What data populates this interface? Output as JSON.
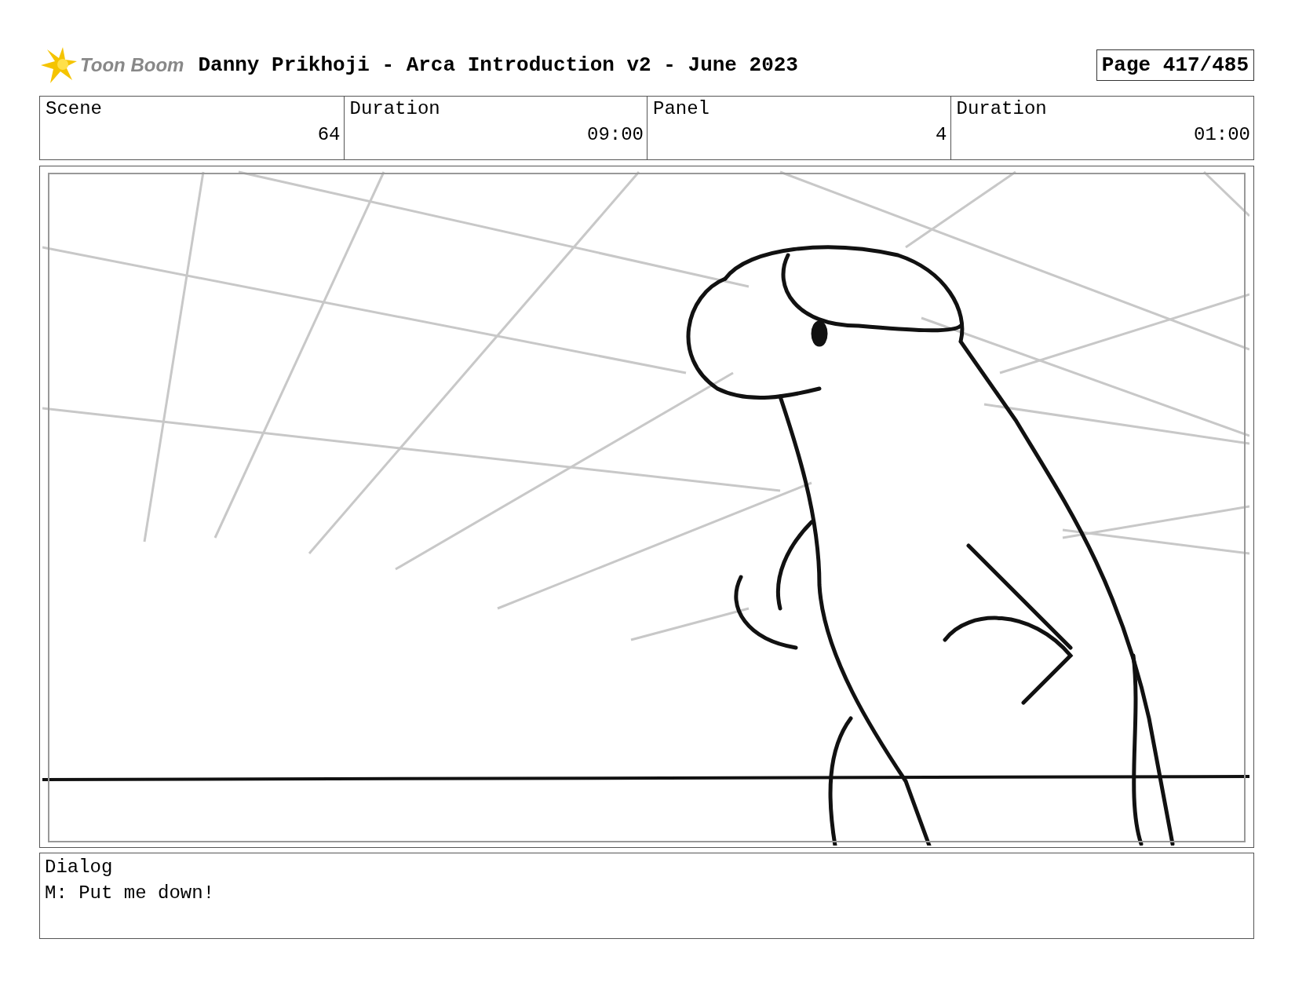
{
  "header": {
    "logo_text": "Toon Boom",
    "title": "Danny Prikhoji - Arca Introduction v2 - June 2023",
    "page": "Page 417/485"
  },
  "info_table": {
    "columns": [
      "Scene",
      "Duration",
      "Panel",
      "Duration"
    ],
    "values": [
      "64",
      "09:00",
      "4",
      "01:00"
    ]
  },
  "dialog": {
    "label": "Dialog",
    "text": "M: Put me down!"
  }
}
